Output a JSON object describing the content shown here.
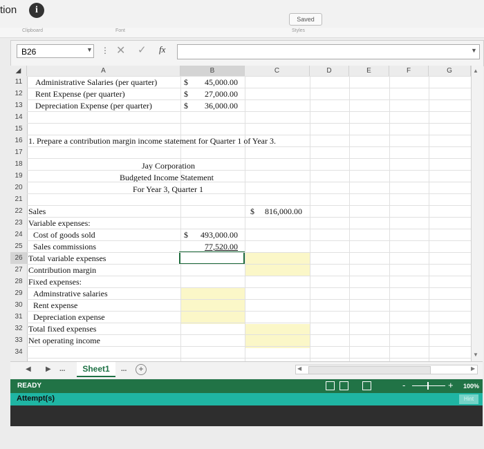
{
  "top": {
    "title_fragment": "tion",
    "info_symbol": "i",
    "saved": "Saved"
  },
  "ribbon": {
    "left_fragment": "Clipboard",
    "mid_fragment": "Font",
    "right_fragment": "Styles"
  },
  "formula_bar": {
    "name_box": "B26",
    "fx": "fx",
    "formula": ""
  },
  "columns": [
    "A",
    "B",
    "C",
    "D",
    "E",
    "F",
    "G"
  ],
  "rows": [
    "11",
    "12",
    "13",
    "14",
    "15",
    "16",
    "17",
    "18",
    "19",
    "20",
    "21",
    "22",
    "23",
    "24",
    "25",
    "26",
    "27",
    "28",
    "29",
    "30",
    "31",
    "32",
    "33",
    "34"
  ],
  "cells": {
    "a11": "Administrative Salaries (per quarter)",
    "s11": "$",
    "b11": "45,000.00",
    "a12": "Rent Expense (per quarter)",
    "s12": "$",
    "b12": "27,000.00",
    "a13": "Depreciation Expense (per quarter)",
    "s13": "$",
    "b13": "36,000.00",
    "a16": "1. Prepare a contribution margin income statement for Quarter 1 of Year 3.",
    "h18": "Jay Corporation",
    "h19": "Budgeted Income Statement",
    "h20": "For Year 3, Quarter 1",
    "a22": "Sales",
    "s22": "$",
    "c22": "816,000.00",
    "a23": "Variable expenses:",
    "a24": "Cost of goods sold",
    "s24": "$",
    "b24": "493,000.00",
    "a25": "Sales commissions",
    "b25": "77,520.00",
    "a26": "Total variable expenses",
    "a27": "Contribution margin",
    "a28": "Fixed expenses:",
    "a29": "Adminstrative salaries",
    "a30": "Rent expense",
    "a31": "Depreciation expense",
    "a32": "Total fixed expenses",
    "a33": "Net operating income"
  },
  "sheet_tabs": {
    "nav_prev": "◀",
    "nav_next": "▶",
    "more": "...",
    "active": "Sheet1",
    "more_right": "...",
    "add": "+"
  },
  "status": {
    "ready": "READY",
    "zoom": "100%",
    "minus": "-",
    "plus": "+"
  },
  "attempts": {
    "label": "Attempt(s)",
    "hint": "Hint"
  },
  "colors": {
    "excel_green": "#217346",
    "teal": "#1fb5a3",
    "input_yellow": "#fbf7c8"
  }
}
